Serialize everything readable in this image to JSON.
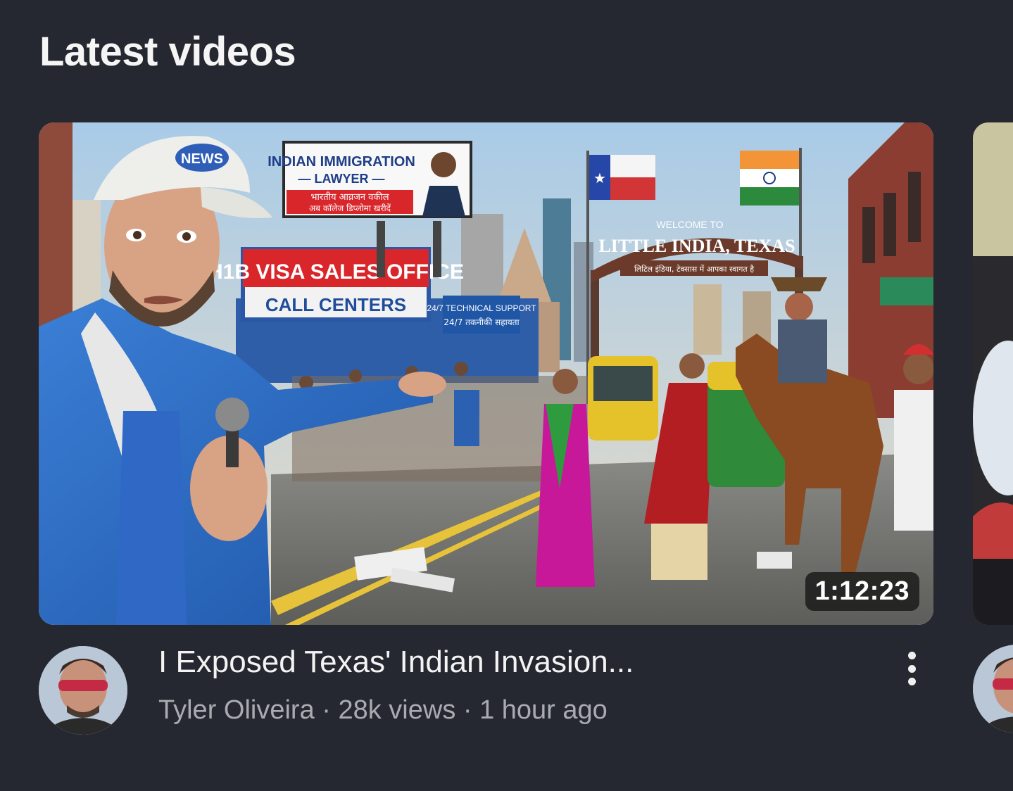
{
  "section": {
    "title": "Latest videos"
  },
  "video": {
    "title": "I Exposed Texas' Indian Invasion...",
    "channel": "Tyler Oliveira",
    "views": "28k views",
    "age": "1 hour ago",
    "subtitle": "Tyler Oliveira · 28k views · 1 hour ago",
    "duration": "1:12:23",
    "more_icon": "more-vert-icon"
  },
  "thumbnail_text": {
    "cap_logo": "NEWS",
    "billboard_line1": "INDIAN IMMIGRATION",
    "billboard_line2": "— LAWYER —",
    "billboard_hindi1": "भारतीय आव्रजन वकील",
    "billboard_hindi2": "अब कॉलेज डिप्लोमा खरीदें",
    "storefront_line1": "H1B VISA SALES OFFICE",
    "storefront_line2": "CALL CENTERS",
    "support_sign1": "24/7 TECHNICAL SUPPORT",
    "support_sign2": "24/7 तकनीकी सहायता",
    "arch_welcome": "WELCOME TO",
    "arch_main": "LITTLE INDIA, TEXAS",
    "arch_hindi": "लिटिल इंडिया, टेक्सास में आपका स्वागत है"
  },
  "colors": {
    "background": "#252830",
    "title_text": "#f5f5f5",
    "subtitle_text": "#a9abb0"
  }
}
